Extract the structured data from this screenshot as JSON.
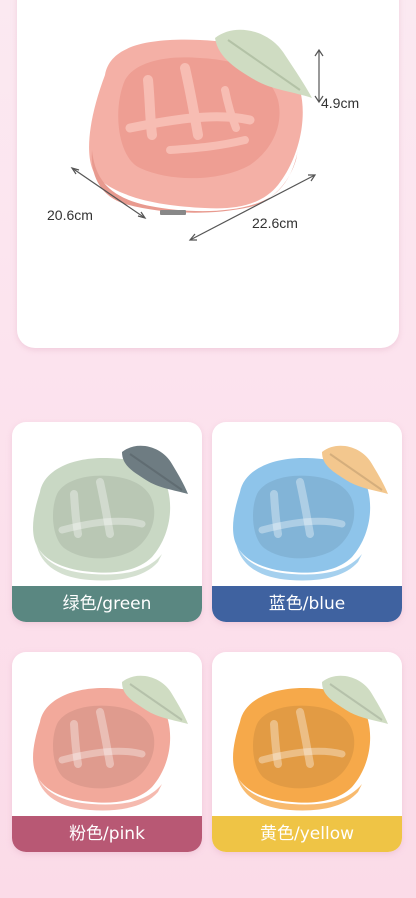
{
  "dimensions": {
    "height": "4.9cm",
    "width": "20.6cm",
    "length": "22.6cm"
  },
  "variants": [
    {
      "label": "绿色/green",
      "bowl_color": "#c9d8c4",
      "band_color": "#5a8781",
      "leaf_color": "#6e7c82"
    },
    {
      "label": "蓝色/blue",
      "bowl_color": "#8ec4ea",
      "band_color": "#3f62a0",
      "leaf_color": "#f3c78e"
    },
    {
      "label": "粉色/pink",
      "bowl_color": "#f2a99b",
      "band_color": "#b85874",
      "leaf_color": "#cfdcc2"
    },
    {
      "label": "黄色/yellow",
      "bowl_color": "#f6a94a",
      "band_color": "#efc445",
      "leaf_color": "#cfdcc2"
    }
  ],
  "hero": {
    "bowl_color": "#f4b0a6",
    "leaf_color": "#cfdcc2"
  }
}
